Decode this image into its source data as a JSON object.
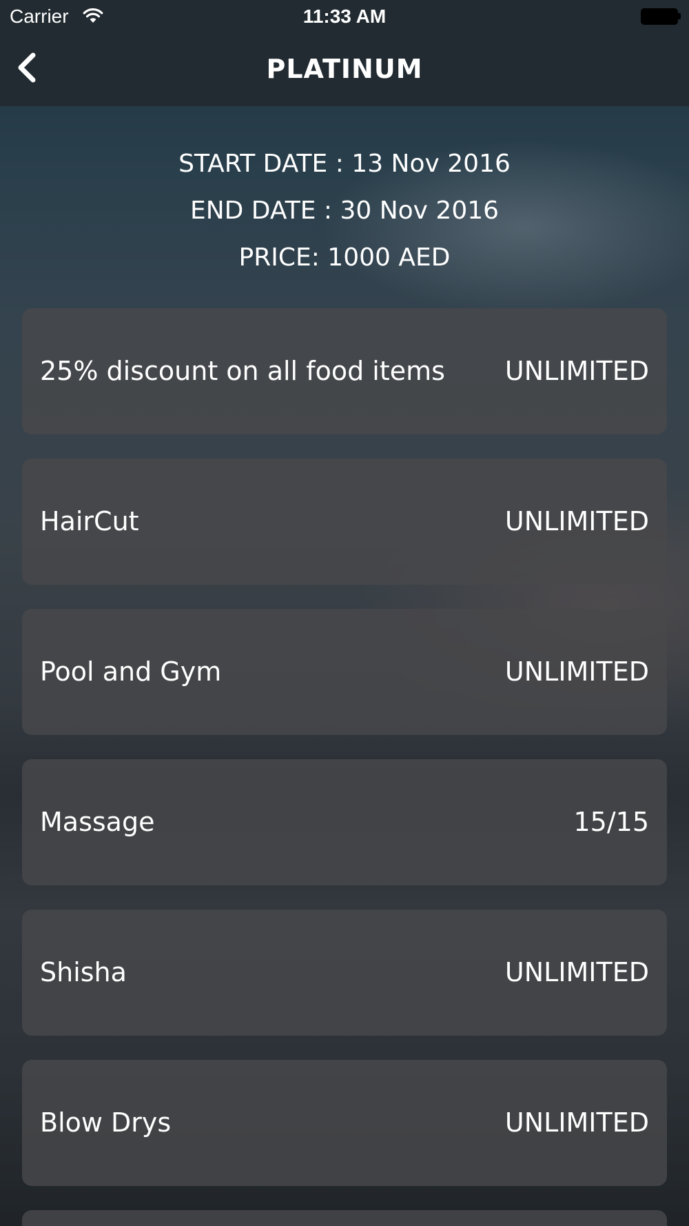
{
  "status_bar": {
    "carrier": "Carrier",
    "time": "11:33 AM",
    "wifi_icon": "wifi-icon",
    "battery_icon": "battery-icon"
  },
  "nav": {
    "title": "PLATINUM",
    "back_icon": "chevron-left-icon"
  },
  "membership": {
    "start_date": "START DATE : 13 Nov 2016",
    "end_date": "END DATE : 30 Nov 2016",
    "price": "PRICE: 1000 AED"
  },
  "benefits": [
    {
      "name": "25% discount on all food items",
      "value": "UNLIMITED"
    },
    {
      "name": "HairCut",
      "value": "UNLIMITED"
    },
    {
      "name": "Pool and Gym",
      "value": "UNLIMITED"
    },
    {
      "name": "Massage",
      "value": "15/15"
    },
    {
      "name": "Shisha",
      "value": "UNLIMITED"
    },
    {
      "name": "Blow Drys",
      "value": "UNLIMITED"
    }
  ],
  "colors": {
    "bar_background": "#222b31",
    "card_background": "#48484a",
    "text": "#ffffff"
  }
}
